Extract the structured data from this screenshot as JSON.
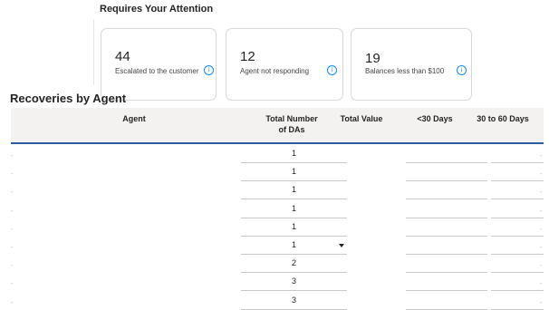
{
  "attention": {
    "title": "Requires Your Attention",
    "cards": [
      {
        "value": "44",
        "label": "Escalated to the customer",
        "icon": "info-icon"
      },
      {
        "value": "12",
        "label": "Agent not responding",
        "icon": "info-icon"
      },
      {
        "value": "19",
        "label": "Balances less than $100",
        "icon": "info-icon"
      }
    ]
  },
  "recoveries": {
    "title": "Recoveries by Agent",
    "columns": {
      "agent": "Agent",
      "total_number_line1": "Total Number",
      "total_number_line2": "of DAs",
      "total_value": "Total Value",
      "lt30": "<30 Days",
      "d30_60": "30 to 60 Days"
    },
    "sort_icon": "sort-descending-icon",
    "rows": [
      {
        "total_number": "1"
      },
      {
        "total_number": "1"
      },
      {
        "total_number": "1"
      },
      {
        "total_number": "1"
      },
      {
        "total_number": "1"
      },
      {
        "total_number": "1"
      },
      {
        "total_number": "2"
      },
      {
        "total_number": "3"
      },
      {
        "total_number": "3"
      }
    ]
  },
  "colors": {
    "accent": "#2c5b9e",
    "info_icon": "#118dff",
    "header_bg": "#f3f2f1"
  }
}
